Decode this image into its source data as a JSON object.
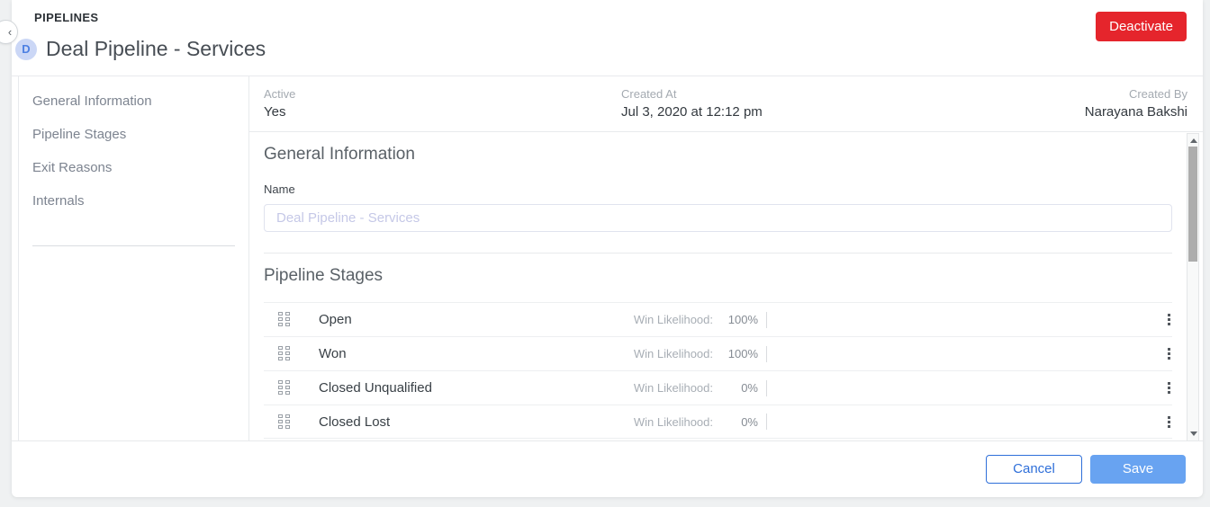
{
  "header": {
    "breadcrumb": "PIPELINES",
    "avatar_initial": "D",
    "title": "Deal Pipeline - Services",
    "deactivate_label": "Deactivate"
  },
  "sidebar": {
    "items": [
      {
        "label": "General Information"
      },
      {
        "label": "Pipeline Stages"
      },
      {
        "label": "Exit Reasons"
      },
      {
        "label": "Internals"
      }
    ]
  },
  "meta": {
    "fields": [
      {
        "label": "Active",
        "value": "Yes"
      },
      {
        "label": "Created At",
        "value": "Jul 3, 2020 at 12:12 pm"
      },
      {
        "label": "Created By",
        "value": "Narayana Bakshi"
      }
    ]
  },
  "general_info": {
    "section_title": "General Information",
    "name_label": "Name",
    "name_placeholder": "Deal Pipeline - Services",
    "name_value": ""
  },
  "pipeline_stages": {
    "section_title": "Pipeline Stages",
    "win_likelihood_label": "Win Likelihood:",
    "stages": [
      {
        "name": "Open",
        "win_likelihood": "100%"
      },
      {
        "name": "Won",
        "win_likelihood": "100%"
      },
      {
        "name": "Closed Unqualified",
        "win_likelihood": "0%"
      },
      {
        "name": "Closed Lost",
        "win_likelihood": "0%"
      }
    ]
  },
  "footer": {
    "cancel_label": "Cancel",
    "save_label": "Save"
  },
  "colors": {
    "deactivate_red": "#e5252c",
    "save_blue": "#68a3f1",
    "cancel_border_blue": "#2e6fd9",
    "avatar_bg": "#cbd7f6",
    "avatar_text": "#4d80e2",
    "placeholder_lavender": "#c5c8e7"
  }
}
